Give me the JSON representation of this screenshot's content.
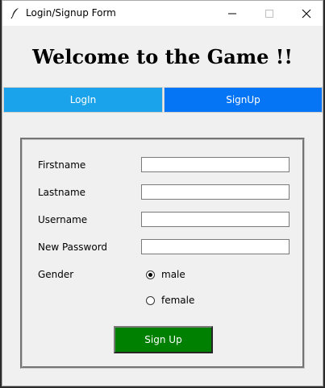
{
  "window": {
    "title": "Login/Signup Form",
    "icon": "feather-icon"
  },
  "header": {
    "welcome_text": "Welcome to the Game !!"
  },
  "tabs": [
    {
      "label": "LogIn",
      "color": "#1aa3ea"
    },
    {
      "label": "SignUp",
      "color": "#0575f5"
    }
  ],
  "form": {
    "fields": [
      {
        "label": "Firstname",
        "value": ""
      },
      {
        "label": "Lastname",
        "value": ""
      },
      {
        "label": "Username",
        "value": ""
      },
      {
        "label": "New Password",
        "value": ""
      }
    ],
    "gender": {
      "label": "Gender",
      "options": [
        {
          "label": "male",
          "selected": true
        },
        {
          "label": "female",
          "selected": false
        }
      ]
    },
    "submit_label": "Sign Up",
    "submit_color": "#008000"
  }
}
